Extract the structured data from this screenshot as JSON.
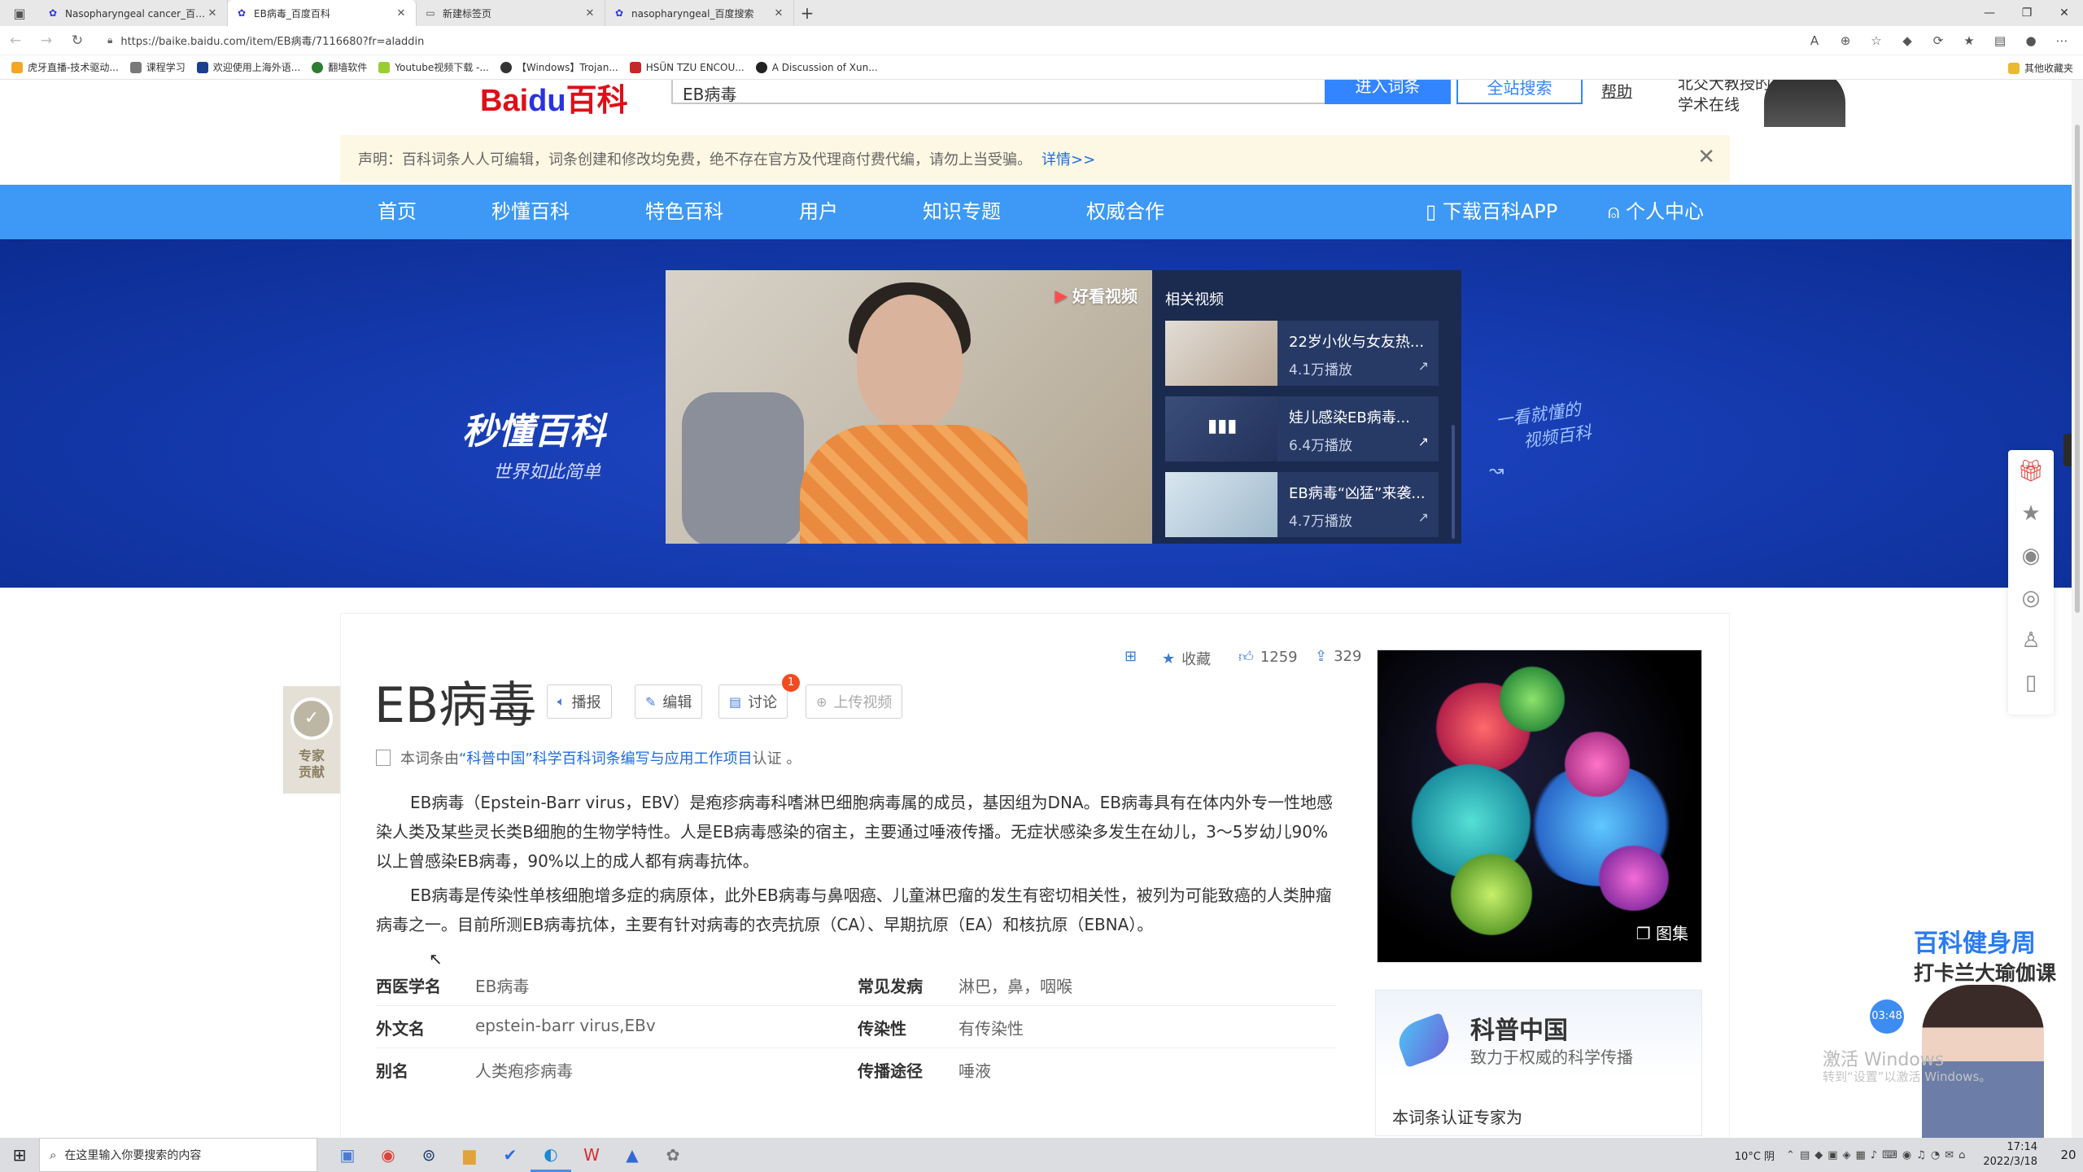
{
  "browser": {
    "tabs": [
      {
        "title": "Nasopharyngeal cancer_百度搜索",
        "active": false
      },
      {
        "title": "EB病毒_百度百科",
        "active": true
      },
      {
        "title": "新建标签页",
        "active": false
      },
      {
        "title": "nasopharyngeal_百度搜索",
        "active": false
      }
    ],
    "new_tab": "+",
    "url": "https://baike.baidu.com/item/EB病毒/7116680?fr=aladdin",
    "bookmarks": [
      {
        "label": "虎牙直播-技术驱动...",
        "color": "#f5a623"
      },
      {
        "label": "课程学习",
        "color": "#7a7a7a"
      },
      {
        "label": "欢迎使用上海外语...",
        "color": "#1b3f8f"
      },
      {
        "label": "翻墙软件",
        "color": "#2e7d32"
      },
      {
        "label": "Youtube视频下载 -...",
        "color": "#9acd32"
      },
      {
        "label": "【Windows】Trojan...",
        "color": "#333333"
      },
      {
        "label": "HSÜN TZU ENCOU...",
        "color": "#c62828"
      },
      {
        "label": "A Discussion of Xun...",
        "color": "#222222"
      }
    ],
    "other_bookmarks": "其他收藏夹"
  },
  "site_header": {
    "logo_red": "Bai",
    "logo_blue": "du",
    "logo_suffix": "百科",
    "search_value": "EB病毒",
    "enter_button": "进入词条",
    "all_search_button": "全站搜索",
    "help": "帮助",
    "promo_line1": "北交大教授的",
    "promo_line2": "学术在线"
  },
  "notice": {
    "text": "声明：百科词条人人可编辑，词条创建和修改均免费，绝不存在官方及代理商付费代编，请勿上当受骗。",
    "more": "详情>>",
    "close": "✕"
  },
  "main_nav": {
    "items": [
      "首页",
      "秒懂百科",
      "特色百科",
      "用户",
      "知识专题",
      "权威合作"
    ],
    "download_app": "下载百科APP",
    "personal_center": "个人中心"
  },
  "banner": {
    "logo": "秒懂百科",
    "slogan": "世界如此简单",
    "handwriting_line1": "一看就懂的",
    "handwriting_line2": "视频百科",
    "video_brand": "好看视频",
    "related_header": "相关视频",
    "related": [
      {
        "title": "22岁小伙与女友热...",
        "plays": "4.1万播放"
      },
      {
        "title": "娃儿感染EB病毒...",
        "plays": "6.4万播放"
      },
      {
        "title": "EB病毒“凶猛”来袭...",
        "plays": "4.7万播放"
      }
    ]
  },
  "lemma": {
    "title": "EB病毒",
    "tools": {
      "play": "播报",
      "edit": "编辑",
      "discuss": "讨论",
      "upload": "上传视频"
    },
    "discuss_badge": "1",
    "collect": "收藏",
    "likes": "1259",
    "shares": "329",
    "expert_label": "专家贡献",
    "cert_prefix": "本词条由",
    "cert_link": "“科普中国”科学百科词条编写与应用工作项目",
    "cert_suffix": " 认证 。",
    "paragraphs": [
      "EB病毒（Epstein-Barr virus，EBV）是疱疹病毒科嗜淋巴细胞病毒属的成员，基因组为DNA。EB病毒具有在体内外专一性地感染人类及某些灵长类B细胞的生物学特性。人是EB病毒感染的宿主，主要通过唾液传播。无症状感染多发生在幼儿，3～5岁幼儿90%以上曾感染EB病毒，90%以上的成人都有病毒抗体。",
      "EB病毒是传染性单核细胞增多症的病原体，此外EB病毒与鼻咽癌、儿童淋巴瘤的发生有密切相关性，被列为可能致癌的人类肿瘤病毒之一。目前所测EB病毒抗体，主要有针对病毒的衣壳抗原（CA）、早期抗原（EA）和核抗原（EBNA）。"
    ],
    "basic_info": [
      {
        "k1": "西医学名",
        "v1": "EB病毒",
        "k2": "常见发病",
        "v2": "淋巴，鼻，咽喉"
      },
      {
        "k1": "外文名",
        "v1": "epstein-barr virus,EBv",
        "k2": "传染性",
        "v2": "有传染性"
      },
      {
        "k1": "别名",
        "v1": "人类疱疹病毒",
        "k2": "传播途径",
        "v2": "唾液"
      }
    ],
    "gallery": "图集"
  },
  "kepu": {
    "title": "科普中国",
    "subtitle": "致力于权威的科学传播",
    "expert_line": "本词条认证专家为"
  },
  "ad": {
    "title": "百科健身周",
    "subtitle": "打卡兰大瑜伽课",
    "timer": "03:48"
  },
  "windows": {
    "activate_title": "激活 Windows",
    "activate_sub": "转到“设置”以激活 Windows。"
  },
  "taskbar": {
    "search_placeholder": "在这里输入你要搜索的内容",
    "weather": "10°C 阴",
    "time": "17:14",
    "date": "2022/3/18",
    "notifications": "20"
  }
}
